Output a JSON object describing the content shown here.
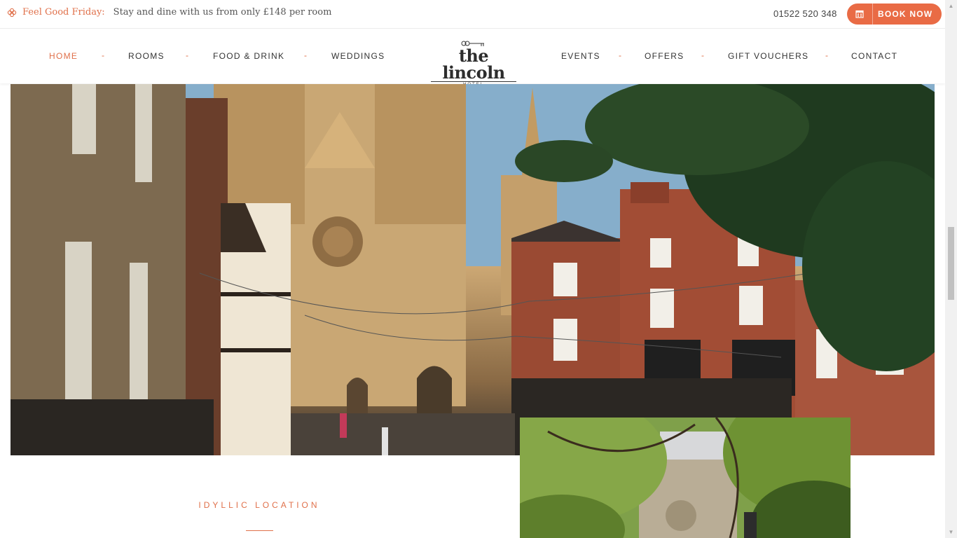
{
  "promo": {
    "icon": "flower-icon",
    "highlight": "Feel Good Friday:",
    "text": "Stay and dine with us from only £148 per room"
  },
  "header": {
    "phone": "01522 520 348",
    "book_label": "BOOK NOW",
    "book_icon": "calendar-icon"
  },
  "nav": {
    "left": [
      "HOME",
      "ROOMS",
      "FOOD & DRINK",
      "WEDDINGS"
    ],
    "right": [
      "EVENTS",
      "OFFERS",
      "GIFT VOUCHERS",
      "CONTACT"
    ],
    "separator": "-",
    "active": "HOME"
  },
  "logo": {
    "text": "the lincoln",
    "sub": "HOTEL"
  },
  "section": {
    "title": "IDYLLIC LOCATION"
  },
  "colors": {
    "accent": "#e96b45",
    "text": "#333333"
  }
}
